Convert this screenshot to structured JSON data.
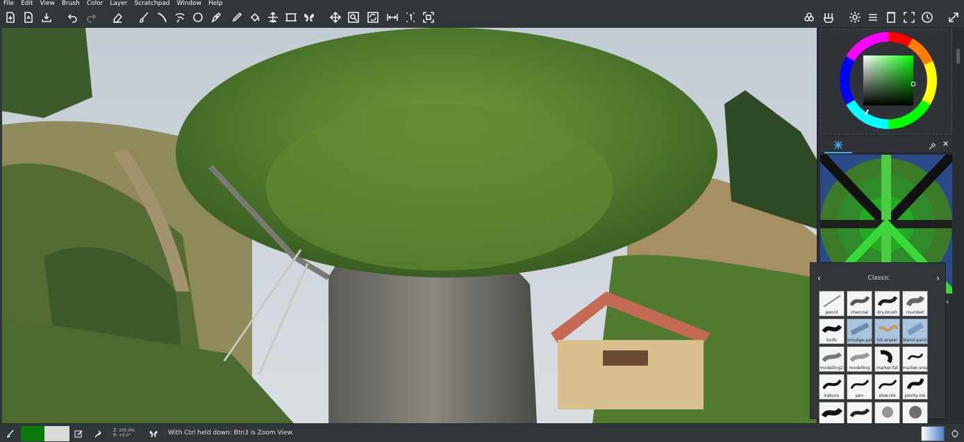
{
  "menu": [
    "File",
    "Edit",
    "View",
    "Brush",
    "Color",
    "Layer",
    "Scratchpad",
    "Window",
    "Help"
  ],
  "toolbar_icons": [
    "new-document-icon",
    "open-document-icon",
    "save-icon",
    "undo-icon",
    "redo-icon",
    "eraser-icon",
    "brush-icon",
    "calligraphy-icon",
    "lasso-icon",
    "ellipse-icon",
    "pen-tool-icon",
    "color-picker-icon",
    "fill-icon",
    "move-icon",
    "frame-icon",
    "symmetry-icon",
    "pan-icon",
    "zoom-icon",
    "rotate-icon",
    "flip-icon",
    "one-to-one-icon",
    "fit-icon",
    "layers-icon",
    "brush-settings-icon",
    "settings-icon",
    "menu-icon",
    "scratchpad-icon",
    "fullscreen-icon",
    "timer-icon",
    "expand-icon"
  ],
  "brush_popup": {
    "title": "Classic",
    "presets": [
      {
        "label": "pencil"
      },
      {
        "label": "charcoal"
      },
      {
        "label": "dry-brush"
      },
      {
        "label": "rounded"
      },
      {
        "label": "knife"
      },
      {
        "label": "smudge-paint"
      },
      {
        "label": "ink-eraser"
      },
      {
        "label": "blend-paint"
      },
      {
        "label": "modelling2"
      },
      {
        "label": "modelling"
      },
      {
        "label": "marker-fat"
      },
      {
        "label": "marker-small"
      },
      {
        "label": "kabura"
      },
      {
        "label": "pen"
      },
      {
        "label": "slow-ink"
      },
      {
        "label": "pointy-ink"
      },
      {
        "label": ""
      },
      {
        "label": ""
      },
      {
        "label": ""
      },
      {
        "label": ""
      }
    ]
  },
  "status": {
    "zoom_line1": "Z: 100.0%",
    "zoom_line2": "R: +0.0°",
    "message": "With Ctrl held down:  Btn3 is Zoom View."
  },
  "colors": {
    "foreground": "#0a7a0a",
    "background": "#d9d9d9",
    "accent": "#3daee9"
  }
}
